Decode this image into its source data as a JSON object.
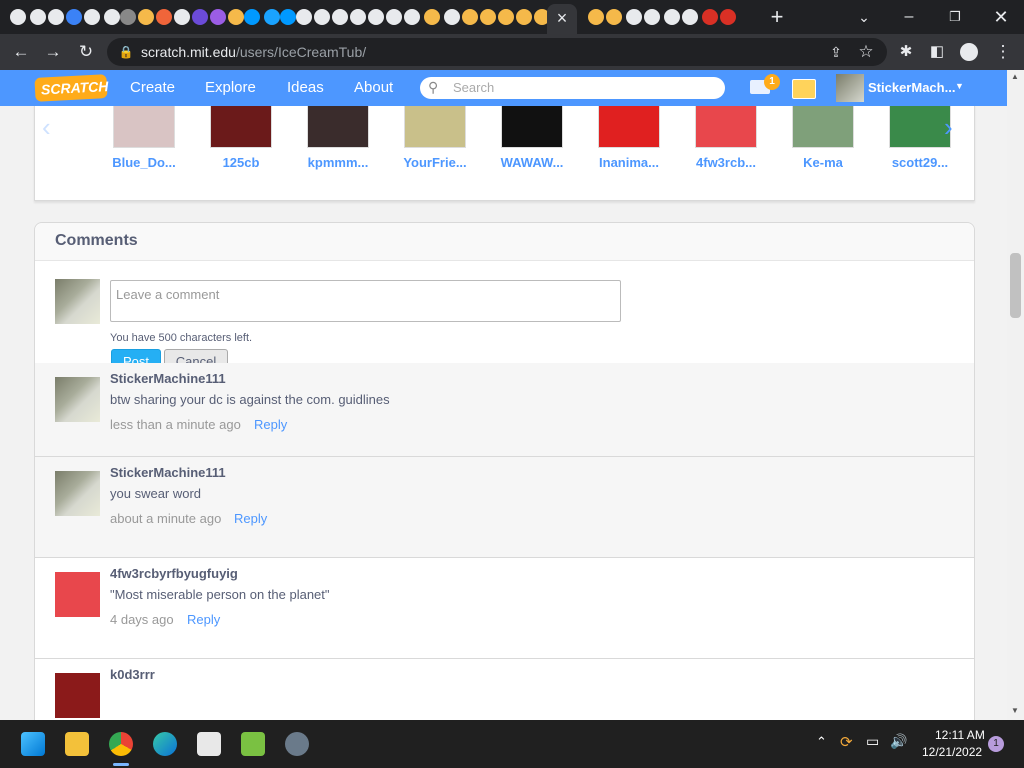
{
  "browser": {
    "url_domain": "scratch.mit.edu",
    "url_path": "/users/IceCreamTub/",
    "new_tab": "+",
    "tab_close": "×"
  },
  "nav": {
    "logo": "SCRATCH",
    "links": [
      "Create",
      "Explore",
      "Ideas",
      "About"
    ],
    "search_placeholder": "Search",
    "message_count": "1",
    "username": "StickerMach..."
  },
  "followers": [
    {
      "name": "Blue_Do...",
      "color": "#d9c4c4"
    },
    {
      "name": "125cb",
      "color": "#6b1a1a"
    },
    {
      "name": "kpmmm...",
      "color": "#3a2c2c"
    },
    {
      "name": "YourFrie...",
      "color": "#c9c08a"
    },
    {
      "name": "WAWAW...",
      "color": "#111111"
    },
    {
      "name": "Inanima...",
      "color": "#e02020"
    },
    {
      "name": "4fw3rcb...",
      "color": "#e8474c"
    },
    {
      "name": "Ke-ma",
      "color": "#7fa07a"
    },
    {
      "name": "scott29...",
      "color": "#3a8a4a"
    }
  ],
  "comments_section": {
    "title": "Comments",
    "placeholder": "Leave a comment",
    "chars_left": "You have 500 characters left.",
    "post_label": "Post",
    "cancel_label": "Cancel"
  },
  "comments": [
    {
      "user": "StickerMachine111",
      "text": "btw sharing your dc is against the com. guidlines",
      "time": "less than a minute ago",
      "reply": "Reply",
      "avatar": "laptop"
    },
    {
      "user": "StickerMachine111",
      "text": "you swear word",
      "time": "about a minute ago",
      "reply": "Reply",
      "avatar": "laptop"
    },
    {
      "user": "4fw3rcbyrfbyugfuyig",
      "text": "\"Most miserable person on the planet\"",
      "time": "4 days ago",
      "reply": "Reply",
      "avatar": "red"
    },
    {
      "user": "k0d3rrr",
      "text": "",
      "time": "",
      "reply": "",
      "avatar": "dark"
    }
  ],
  "taskbar": {
    "time": "12:11 AM",
    "date": "12/21/2022",
    "notification_count": "1"
  },
  "colors": {
    "scratch_blue": "#4d97ff",
    "post_blue": "#25aff4",
    "chrome_dark": "#35363a"
  }
}
